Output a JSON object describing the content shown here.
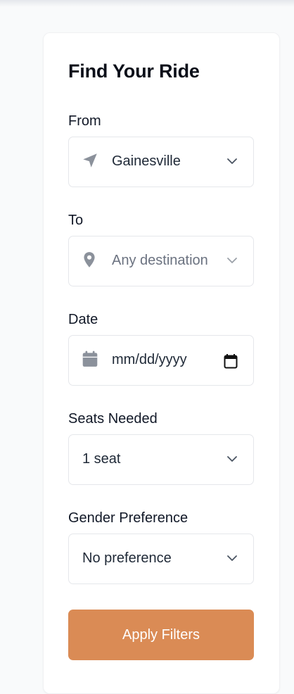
{
  "form": {
    "title": "Find Your Ride",
    "from": {
      "label": "From",
      "value": "Gainesville"
    },
    "to": {
      "label": "To",
      "placeholder": "Any destination"
    },
    "date": {
      "label": "Date",
      "placeholder": "mm/dd/yyyy"
    },
    "seats": {
      "label": "Seats Needed",
      "value": "1 seat"
    },
    "gender": {
      "label": "Gender Preference",
      "value": "No preference"
    },
    "apply_label": "Apply Filters"
  },
  "icons": {
    "from": "navigation-arrow-icon",
    "to": "map-pin-icon",
    "date": "calendar-icon",
    "dropdown": "chevron-down-icon"
  },
  "colors": {
    "accent": "#da8b55",
    "icon": "#9ca3af",
    "border": "#e5e7eb"
  }
}
